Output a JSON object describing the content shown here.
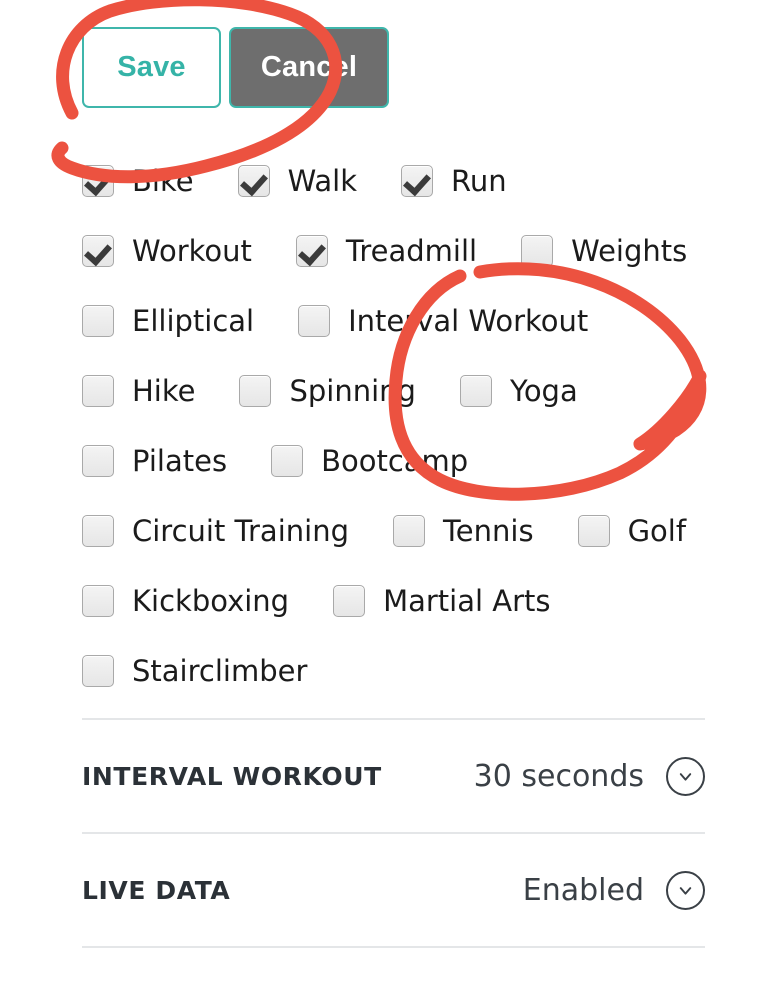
{
  "buttons": {
    "save_label": "Save",
    "cancel_label": "Cancel"
  },
  "activity_checkboxes": {
    "rows": [
      [
        {
          "label": "Bike",
          "checked": true
        },
        {
          "label": "Walk",
          "checked": true
        },
        {
          "label": "Run",
          "checked": true
        }
      ],
      [
        {
          "label": "Workout",
          "checked": true
        },
        {
          "label": "Treadmill",
          "checked": true
        },
        {
          "label": "Weights",
          "checked": false
        }
      ],
      [
        {
          "label": "Elliptical",
          "checked": false
        },
        {
          "label": "Interval Workout",
          "checked": false
        }
      ],
      [
        {
          "label": "Hike",
          "checked": false
        },
        {
          "label": "Spinning",
          "checked": false
        },
        {
          "label": "Yoga",
          "checked": false
        }
      ],
      [
        {
          "label": "Pilates",
          "checked": false
        },
        {
          "label": "Bootcamp",
          "checked": false
        }
      ],
      [
        {
          "label": "Circuit Training",
          "checked": false
        },
        {
          "label": "Tennis",
          "checked": false
        },
        {
          "label": "Golf",
          "checked": false
        }
      ],
      [
        {
          "label": "Kickboxing",
          "checked": false
        },
        {
          "label": "Martial Arts",
          "checked": false
        }
      ],
      [
        {
          "label": "Stairclimber",
          "checked": false
        }
      ]
    ]
  },
  "settings": [
    {
      "label": "INTERVAL WORKOUT",
      "value": "30 seconds",
      "icon": "chevron-down-icon"
    },
    {
      "label": "LIVE DATA",
      "value": "Enabled",
      "icon": "chevron-down-icon"
    }
  ],
  "annotations": {
    "ink_color": "#ec5240",
    "marks": [
      {
        "name": "circle-around-save-button"
      },
      {
        "name": "circle-around-yoga-checkbox"
      }
    ]
  },
  "colors": {
    "accent_teal": "#35b3a7",
    "cancel_gray": "#6e6e6e",
    "text_dark": "#1b1b1b",
    "divider": "#e4e6e8",
    "annotation_red": "#ec5240"
  }
}
